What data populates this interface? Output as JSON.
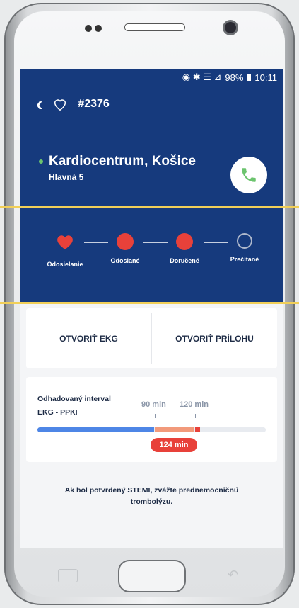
{
  "statusbar": {
    "signal_text": "◉ ✱ ☰ ⊿",
    "battery_pct": "98%",
    "time": "10:11"
  },
  "header": {
    "case_id": "#2376",
    "icons": [
      "back-icon",
      "heart-outline-icon"
    ]
  },
  "hospital": {
    "name": "Kardiocentrum, Košice",
    "address": "Hlavná 5"
  },
  "steps": [
    {
      "label": "Odosielanie",
      "state": "heart"
    },
    {
      "label": "Odoslané",
      "state": "done"
    },
    {
      "label": "Doručené",
      "state": "done"
    },
    {
      "label": "Prečítané",
      "state": "pending"
    }
  ],
  "actions": {
    "open_ekg": "OTVORIŤ EKG",
    "open_attachment": "OTVORIŤ PRÍLOHU"
  },
  "interval": {
    "title_line1": "Odhadovaný interval",
    "title_line2": "EKG - PPKI",
    "marker1": "90 min",
    "marker2": "120 min",
    "value": "124 min"
  },
  "note": "Ak bol potvrdený STEMI, zvážte prednemocničnú trombolýzu.",
  "colors": {
    "header": "#163a7d",
    "accent_red": "#e8413a",
    "bar_blue": "#4e86e6",
    "gold": "#f1cf58"
  }
}
